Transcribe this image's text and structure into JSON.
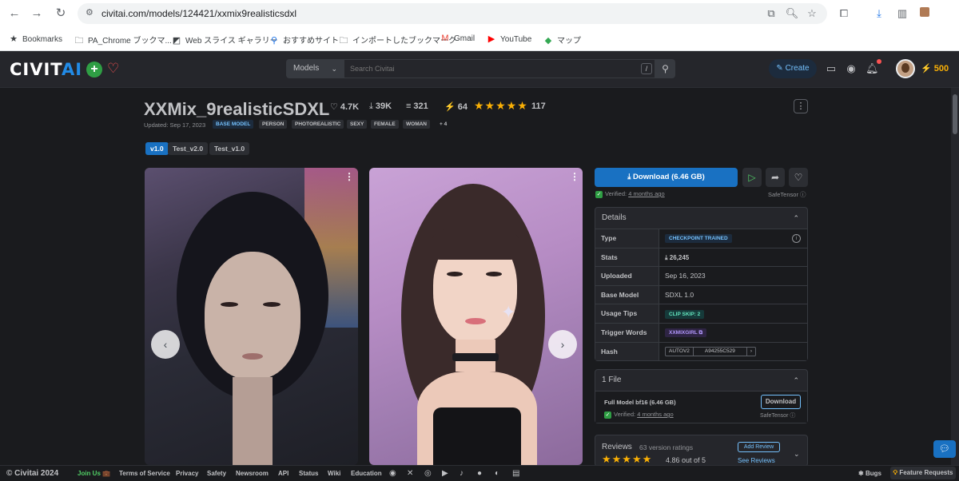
{
  "browser": {
    "url": "civitai.com/models/124421/xxmix9realisticsdxl",
    "bookmarks": [
      {
        "label": "Bookmarks",
        "icon": "star-icon"
      },
      {
        "label": "PA_Chrome ブックマ...",
        "icon": "folder-icon"
      },
      {
        "label": "Web スライス ギャラリー",
        "icon": "web-slice-icon"
      },
      {
        "label": "おすすめサイト",
        "icon": "search-icon"
      },
      {
        "label": "インポートしたブックマーク",
        "icon": "folder-icon"
      },
      {
        "label": "Gmail",
        "icon": "gmail-icon"
      },
      {
        "label": "YouTube",
        "icon": "youtube-icon"
      },
      {
        "label": "マップ",
        "icon": "maps-icon"
      }
    ]
  },
  "header": {
    "logo_left": "CIVIT",
    "logo_right": "AI",
    "search_category": "Models",
    "search_placeholder": "Search Civitai",
    "search_shortcut": "/",
    "create_label": "Create",
    "buzz_amount": "500"
  },
  "model": {
    "title": "XXMix_9realisticSDXL",
    "stats": {
      "likes": "4.7K",
      "downloads": "39K",
      "comments": "321",
      "buzz": "64",
      "rating_count": "117"
    },
    "updated": "Updated: Sep 17, 2023",
    "base_tag": "BASE MODEL",
    "tags": [
      "PERSON",
      "PHOTOREALISTIC",
      "SEXY",
      "FEMALE",
      "WOMAN"
    ],
    "more_tags": "+ 4",
    "versions": [
      "v1.0",
      "Test_v2.0",
      "Test_v1.0"
    ]
  },
  "download": {
    "label": "Download (6.46 GB)",
    "verified_prefix": "Verified:",
    "verified_time": "4 months ago",
    "safetensor": "SafeTensor"
  },
  "details": {
    "heading": "Details",
    "rows": {
      "type_label": "Type",
      "type_value": "CHECKPOINT TRAINED",
      "stats_label": "Stats",
      "stats_value": "26,245",
      "uploaded_label": "Uploaded",
      "uploaded_value": "Sep 16, 2023",
      "base_label": "Base Model",
      "base_value": "SDXL 1.0",
      "tips_label": "Usage Tips",
      "tips_value": "CLIP SKIP: 2",
      "trigger_label": "Trigger Words",
      "trigger_value": "XXMIXGIRL",
      "hash_label": "Hash",
      "hash_algo": "AUTOV2",
      "hash_value": "A94255C529"
    }
  },
  "files": {
    "heading": "1 File",
    "file_name": "Full Model bf16 (6.46 GB)",
    "download_label": "Download",
    "verified_prefix": "Verified:",
    "verified_time": "4 months ago",
    "safetensor": "SafeTensor"
  },
  "reviews": {
    "heading": "Reviews",
    "count": "63 version ratings",
    "score": "4.86 out of 5",
    "add_review": "Add Review",
    "see_reviews": "See Reviews"
  },
  "footer": {
    "copyright": "© Civitai 2024",
    "join": "Join Us 💼",
    "links": [
      "Terms of Service",
      "Privacy",
      "Safety",
      "Newsroom",
      "API",
      "Status",
      "Wiki",
      "Education"
    ],
    "bugs": "Bugs",
    "feature_requests": "Feature Requests"
  },
  "colors": {
    "accent": "#1971c2",
    "star": "#fab005",
    "background": "#1a1b1e"
  }
}
